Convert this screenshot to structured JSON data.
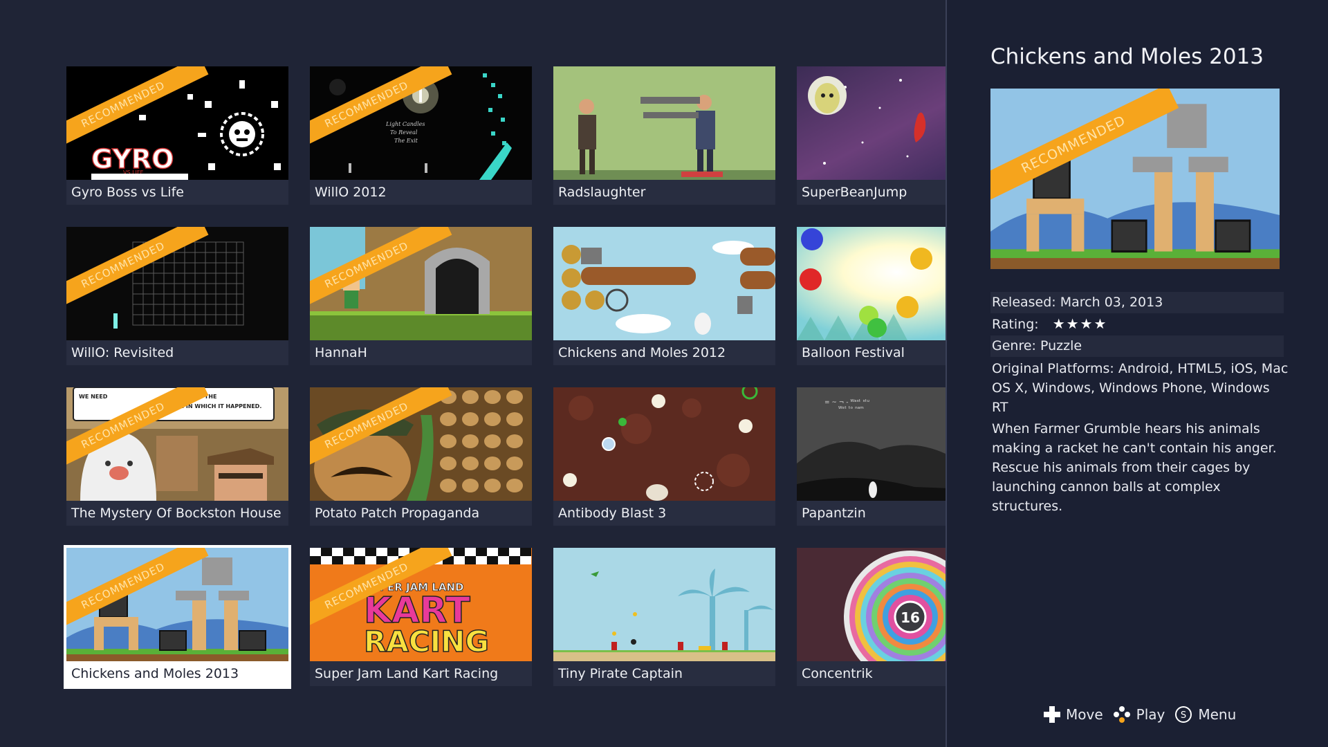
{
  "grid": {
    "tiles": [
      {
        "title": "Gyro Boss vs Life",
        "recommended": true
      },
      {
        "title": "WillO 2012",
        "recommended": true
      },
      {
        "title": "Radslaughter",
        "recommended": false
      },
      {
        "title": "SuperBeanJump",
        "recommended": false
      },
      {
        "title": "WillO: Revisited",
        "recommended": true
      },
      {
        "title": "HannaH",
        "recommended": true
      },
      {
        "title": "Chickens and Moles 2012",
        "recommended": false
      },
      {
        "title": "Balloon Festival",
        "recommended": false
      },
      {
        "title": "The Mystery Of Bockston House",
        "recommended": true
      },
      {
        "title": "Potato Patch Propaganda",
        "recommended": true
      },
      {
        "title": "Antibody Blast 3",
        "recommended": false
      },
      {
        "title": "Papantzin",
        "recommended": false
      },
      {
        "title": "Chickens and Moles 2013",
        "recommended": true,
        "selected": true
      },
      {
        "title": "Super Jam Land Kart Racing",
        "recommended": true
      },
      {
        "title": "Tiny Pirate Captain",
        "recommended": false
      },
      {
        "title": "Concentrik",
        "recommended": false
      }
    ],
    "ribbon_label": "RECOMMENDED",
    "thumb_text": {
      "gyro_logo": "GYRO",
      "gyro_vs": "VS LIFE",
      "willo_line1": "Light Candles",
      "willo_line2": "To Reveal",
      "willo_line3": "The Exit",
      "bockston_bubble_a": "WE NEED",
      "bockston_bubble_b": "LLER. THE",
      "bockston_bubble_c": "THE ROOM IN WHICH IT HAPPENED.",
      "kart_line1": "SUPER JAM LAND",
      "kart_line2": "KART",
      "kart_line3": "RACING",
      "concentrik_number": "16",
      "papantzin_line1": "= ~ ¬ - ᵂᵃˢᵗ ˢᵗᵘ",
      "papantzin_line2": "ᵂᵉᵗ ᵗᵒ ⁿᵃᵐ"
    }
  },
  "panel": {
    "title": "Chickens and Moles 2013",
    "released": "Released: March 03, 2013",
    "rating_label": "Rating:",
    "rating": 4,
    "rating_stars": "★★★★",
    "genre": "Genre: Puzzle",
    "platforms": "Original Platforms: Android, HTML5, iOS, Mac OS X, Windows, Windows Phone, Windows RT",
    "description": "When Farmer Grumble hears his animals making a racket he can't contain his anger. Rescue his animals from their cages by launching cannon balls at complex structures."
  },
  "hints": {
    "move": "Move",
    "play": "Play",
    "menu": "Menu",
    "menu_glyph": "S"
  },
  "colors": {
    "background": "#1f2436",
    "panel": "#1b2033",
    "ribbon": "#f6a41c",
    "caption": "#282d40"
  }
}
